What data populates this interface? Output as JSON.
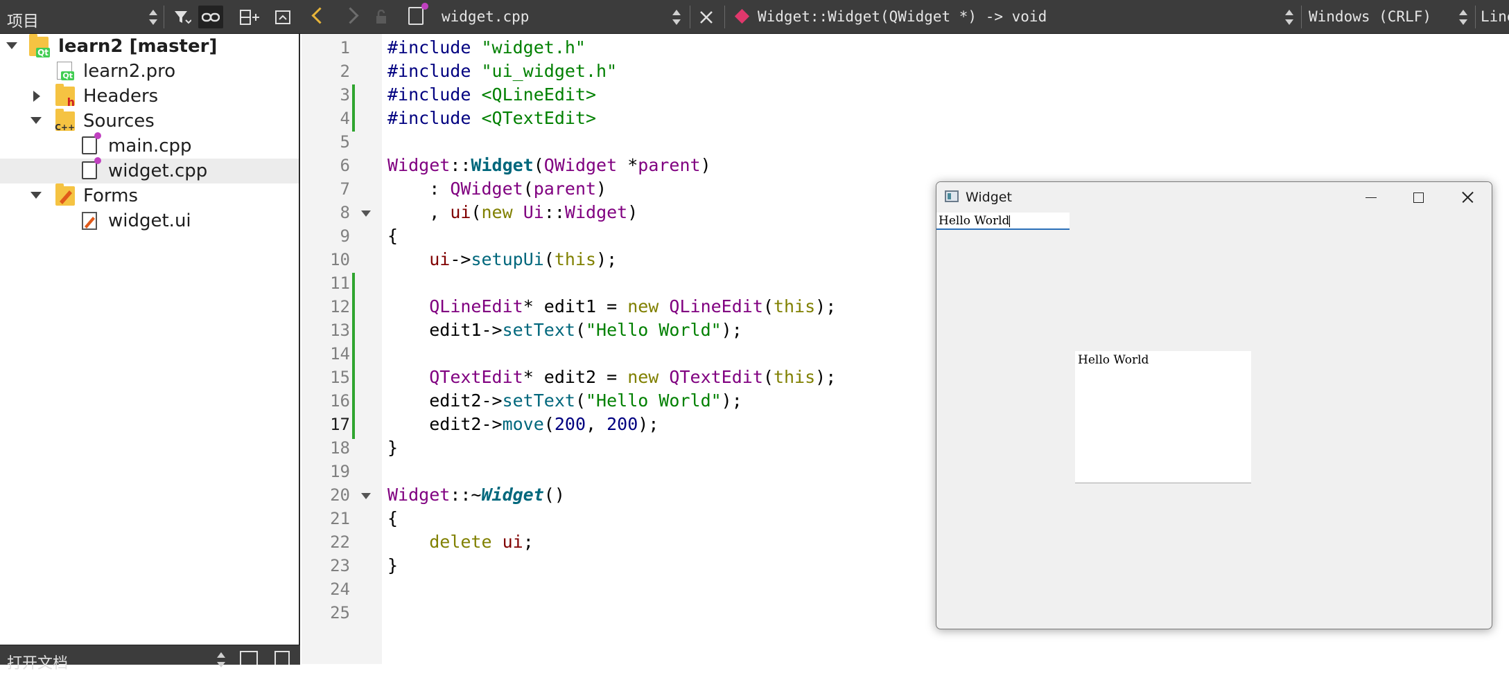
{
  "project_panel": {
    "title": "项目",
    "tree": [
      {
        "label": "learn2 [master]",
        "kind": "project-root",
        "expanded": true
      },
      {
        "label": "learn2.pro",
        "kind": "pro-file"
      },
      {
        "label": "Headers",
        "kind": "folder-headers",
        "expanded": false
      },
      {
        "label": "Sources",
        "kind": "folder-sources",
        "expanded": true
      },
      {
        "label": "main.cpp",
        "kind": "cpp-file"
      },
      {
        "label": "widget.cpp",
        "kind": "cpp-file",
        "selected": true
      },
      {
        "label": "Forms",
        "kind": "folder-forms",
        "expanded": true
      },
      {
        "label": "widget.ui",
        "kind": "ui-file"
      }
    ],
    "bottom_title": "打开文档"
  },
  "editor_bar": {
    "file_name": "widget.cpp",
    "symbol": "Widget::Widget(QWidget *) -> void",
    "line_ending": "Windows (CRLF)",
    "position_label": "Line"
  },
  "editor": {
    "current_line": 17,
    "line_numbers": [
      "1",
      "2",
      "3",
      "4",
      "5",
      "6",
      "7",
      "8",
      "9",
      "10",
      "11",
      "12",
      "13",
      "14",
      "15",
      "16",
      "17",
      "18",
      "19",
      "20",
      "21",
      "22",
      "23",
      "24",
      "25"
    ],
    "lines": [
      "#include \"widget.h\"",
      "#include \"ui_widget.h\"",
      "#include <QLineEdit>",
      "#include <QTextEdit>",
      "",
      "Widget::Widget(QWidget *parent)",
      "    : QWidget(parent)",
      "    , ui(new Ui::Widget)",
      "{",
      "    ui->setupUi(this);",
      "",
      "    QLineEdit* edit1 = new QLineEdit(this);",
      "    edit1->setText(\"Hello World\");",
      "",
      "    QTextEdit* edit2 = new QTextEdit(this);",
      "    edit2->setText(\"Hello World\");",
      "    edit2->move(200, 200);",
      "}",
      "",
      "Widget::~Widget()",
      "{",
      "    delete ui;",
      "}",
      "",
      ""
    ]
  },
  "app_window": {
    "title": "Widget",
    "line_edit_text": "Hello World",
    "text_edit_text": "Hello World"
  },
  "colors": {
    "toolbar_bg": "#3c3c3c",
    "keyword": "#808000",
    "type": "#800080",
    "string": "#008000",
    "preprocessor": "#000080",
    "function": "#00677c",
    "modified_marker": "#2fa52f"
  }
}
